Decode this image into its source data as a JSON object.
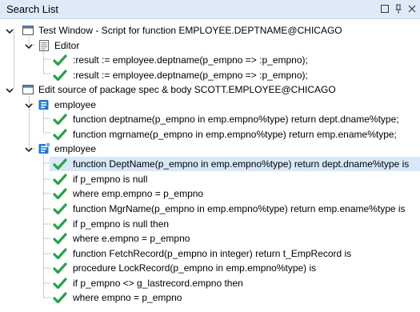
{
  "panel": {
    "title": "Search List"
  },
  "tree": {
    "node_test_window": "Test Window - Script for function EMPLOYEE.DEPTNAME@CHICAGO",
    "node_editor": "Editor",
    "editor_results": [
      ":result := employee.deptname(p_empno => :p_empno);",
      ":result := employee.deptname(p_empno => :p_empno);"
    ],
    "node_edit_source": "Edit source of package spec & body SCOTT.EMPLOYEE@CHICAGO",
    "node_spec": "employee",
    "spec_results": [
      "function deptname(p_empno in emp.empno%type) return dept.dname%type;",
      "function mgrname(p_empno in emp.empno%type) return emp.ename%type;"
    ],
    "node_body": "employee",
    "body_results": [
      "function DeptName(p_empno in emp.empno%type) return dept.dname%type is",
      "if p_empno is null",
      "where emp.empno = p_empno",
      "function MgrName(p_empno in emp.empno%type) return emp.ename%type is",
      "if p_empno is null then",
      "where e.empno = p_empno",
      "function FetchRecord(p_empno in integer) return t_EmpRecord is",
      "procedure LockRecord(p_empno in emp.empno%type) is",
      "if p_empno <> g_lastrecord.empno then",
      "where empno = p_empno"
    ]
  },
  "colors": {
    "titlebar_bg": "#dfeaf8",
    "selected_row": "#d9e8f8",
    "check_green": "#2aa04a",
    "package_icon_blue": "#1e78c8"
  },
  "icons": {
    "expand": "chevron-down-icon",
    "window": "window-icon",
    "editor": "editor-icon",
    "package_spec": "package-spec-icon",
    "package_body": "package-body-icon",
    "result": "checkmark-icon",
    "restore": "restore-icon",
    "pin": "pin-icon",
    "close": "close-icon"
  }
}
